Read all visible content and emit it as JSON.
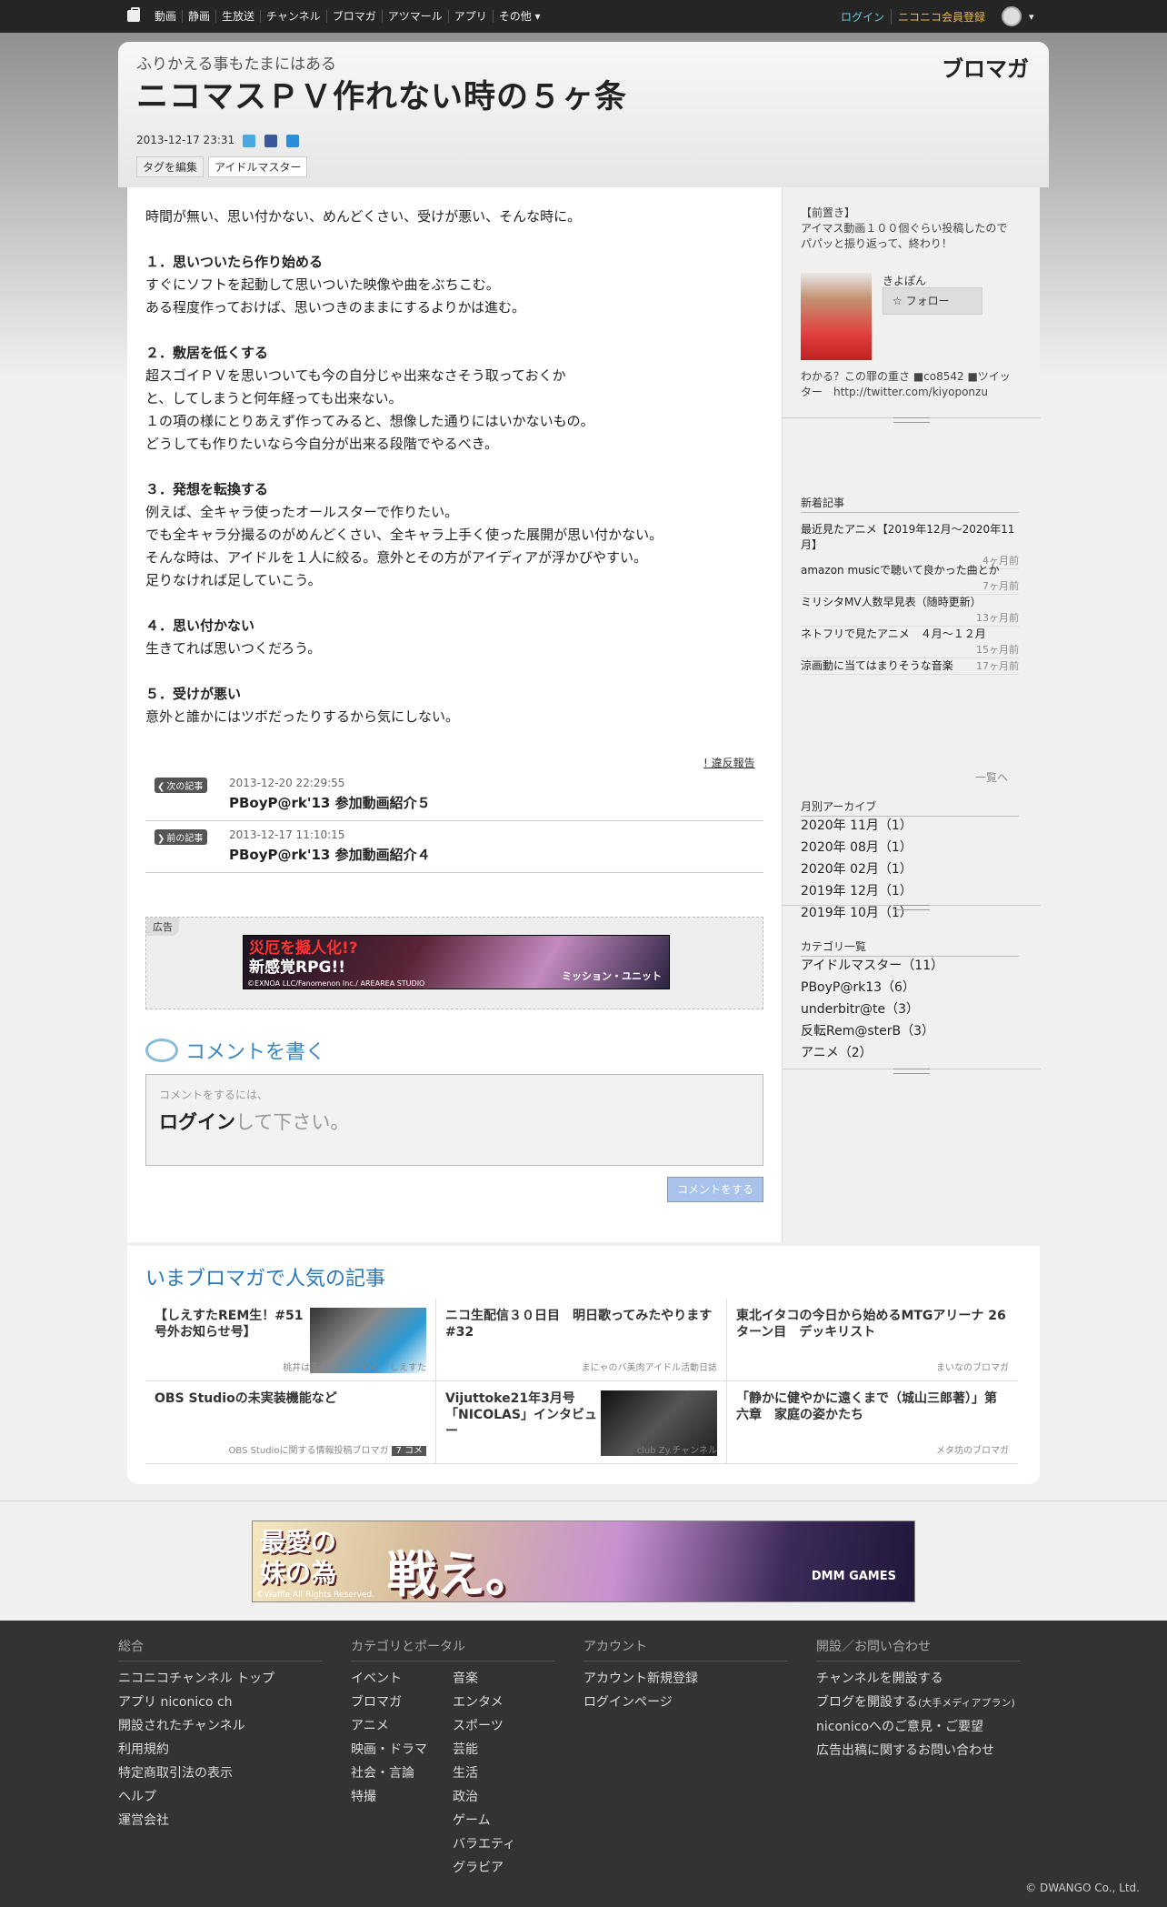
{
  "topbar": {
    "nav": [
      "動画",
      "静画",
      "生放送",
      "チャンネル",
      "ブロマガ",
      "アツマール",
      "アプリ",
      "その他 ▾"
    ],
    "login": "ログイン",
    "register": "ニコニコ会員登録"
  },
  "header": {
    "subtitle": "ふりかえる事もたまにはある",
    "title": "ニコマスＰＶ作れない時の５ヶ条",
    "brand": "ブロマガ",
    "date": "2013-12-17 23:31",
    "tag_edit": "タグを編集",
    "tags": [
      "アイドルマスター"
    ]
  },
  "article": {
    "lines": [
      "時間が無い、思い付かない、めんどくさい、受けが悪い、そんな時に。",
      "",
      "１．思いついたら作り始める",
      "すぐにソフトを起動して思いついた映像や曲をぶちこむ。",
      "ある程度作っておけば、思いつきのままにするよりかは進む。",
      "",
      "２．敷居を低くする",
      "超スゴイＰＶを思いついても今の自分じゃ出来なさそう取っておくか",
      "と、してしまうと何年経っても出来ない。",
      "１の項の様にとりあえず作ってみると、想像した通りにはいかないもの。",
      "どうしても作りたいなら今自分が出来る段階でやるべき。",
      "",
      "３．発想を転換する",
      "例えば、全キャラ使ったオールスターで作りたい。",
      "でも全キャラ分撮るのがめんどくさい、全キャラ上手く使った展開が思い付かない。",
      "そんな時は、アイドルを１人に絞る。意外とその方がアイディアが浮かびやすい。",
      "足りなければ足していこう。",
      "",
      "４．思い付かない",
      "生きてれば思いつくだろう。",
      "",
      "５．受けが悪い",
      "意外と誰かにはツボだったりするから気にしない。"
    ],
    "report": "! 違反報告"
  },
  "nav": {
    "next": {
      "label": "次の記事",
      "date": "2013-12-20 22:29:55",
      "title": "PBoyP@rk'13 参加動画紹介５"
    },
    "prev": {
      "label": "前の記事",
      "date": "2013-12-17 11:10:15",
      "title": "PBoyP@rk'13 参加動画紹介４"
    }
  },
  "ad": {
    "label": "広告",
    "line1": "災厄を擬人化!?",
    "line2": "新感覚RPG!!",
    "copyright": "©EXNOA LLC/Fanomenon Inc./ AREAREA STUDIO",
    "logo": "ミッション・ユニット"
  },
  "comment": {
    "heading": "コメントを書く",
    "hint": "コメントをするには、",
    "login": "ログイン",
    "suffix": "して下さい。",
    "button": "コメントをする"
  },
  "sidebar": {
    "intro": "【前置き】\nアイマス動画１００個ぐらい投稿したのでパパッと振り返って、終わり！",
    "name": "きよぽん",
    "follow": "フォロー",
    "desc": "わかる？この罪の重さ ■co8542 ■ツイッター　http://twitter.com/kiyoponzu",
    "recent_head": "新着記事",
    "recent": [
      {
        "title": "最近見たアニメ【2019年12月～2020年11月】",
        "ago": "4ヶ月前"
      },
      {
        "title": "amazon musicで聴いて良かった曲とか",
        "ago": "7ヶ月前"
      },
      {
        "title": "ミリシタMV人数早見表（随時更新）",
        "ago": "13ヶ月前"
      },
      {
        "title": "ネトフリで見たアニメ　４月～１２月",
        "ago": "15ヶ月前"
      },
      {
        "title": "涼画動に当てはまりそうな音楽",
        "ago": "17ヶ月前"
      }
    ],
    "more": "一覧へ",
    "archive_head": "月別アーカイブ",
    "archive": [
      "2020年 11月（1）",
      "2020年 08月（1）",
      "2020年 02月（1）",
      "2019年 12月（1）",
      "2019年 10月（1）"
    ],
    "cat_head": "カテゴリ一覧",
    "cats": [
      "アイドルマスター（11）",
      "PBoyP@rk13（6）",
      "underbitr@te（3）",
      "反転Rem@sterB（3）",
      "アニメ（2）"
    ]
  },
  "popular": {
    "heading": "いまブロマガで人気の記事",
    "items": [
      {
        "title": "【しえすたREM生！#51 号外お知らせ号】",
        "source": "桃井はるこ(モモーイ)の「しえすた"
      },
      {
        "title": "ニコ生配信３０日目　明日歌ってみたやります #32",
        "source": "まにゃのバ美肉アイドル活動日誌"
      },
      {
        "title": "東北イタコの今日から始めるMTGアリーナ 26ターン目　デッキリスト",
        "source": "まいなのブロマガ"
      },
      {
        "title": "OBS Studioの未実装機能など",
        "source": "OBS Studioに関する情報投稿ブロマガ",
        "comments": "7 コメ"
      },
      {
        "title": "Vijuttoke21年3月号「NICOLAS」インタビュー",
        "source": "club Zy.チャンネル"
      },
      {
        "title": "「静かに健やかに遠くまで（城山三郎著）」第六章　家庭の姿かたち",
        "source": "メタ坊のブロマガ"
      }
    ]
  },
  "bigad": {
    "line1": "最愛の",
    "line2": "妹の為",
    "line3": "戦え。",
    "copyright": "©Waffle All Rights Reserved.",
    "logo": "DMM GAMES"
  },
  "footer": {
    "cols": [
      {
        "head": "総合",
        "links": [
          "ニコニコチャンネル トップ",
          "アプリ niconico ch",
          "開設されたチャンネル",
          "利用規約",
          "特定商取引法の表示",
          "ヘルプ",
          "運営会社"
        ]
      },
      {
        "head": "カテゴリとポータル",
        "links_a": [
          "イベント",
          "ブロマガ",
          "アニメ",
          "映画・ドラマ",
          "社会・言論",
          "特撮"
        ],
        "links_b": [
          "音楽",
          "エンタメ",
          "スポーツ",
          "芸能",
          "生活",
          "政治",
          "ゲーム",
          "バラエティ",
          "グラビア"
        ]
      },
      {
        "head": "アカウント",
        "links": [
          "アカウント新規登録",
          "ログインページ"
        ]
      },
      {
        "head": "開設／お問い合わせ",
        "links": [
          "チャンネルを開設する",
          "ブログを開設する",
          "niconicoへのご意見・ご要望",
          "広告出稿に関するお問い合わせ"
        ],
        "blog_note": "(大手メディアプラン)"
      }
    ],
    "copyright": "© DWANGO Co., Ltd."
  },
  "colors": {
    "accent": "#3b86c4",
    "topbar": "#252525",
    "register": "#e8b842"
  }
}
